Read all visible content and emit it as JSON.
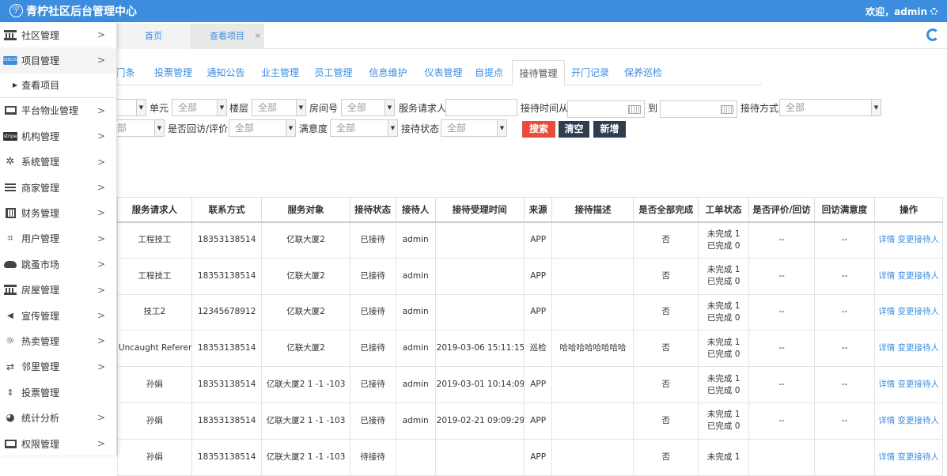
{
  "header": {
    "logo_char": "宁",
    "title": "青柠社区后台管理中心",
    "welcome": "欢迎，admin",
    "gear_icon": "gear-icon"
  },
  "sidebar": {
    "items": [
      {
        "label": "社区管理",
        "icon": "bank-icon",
        "has_arrow": true
      },
      {
        "label": "项目管理",
        "icon": "card-icon",
        "has_arrow": true,
        "open": true
      },
      {
        "label": "查看项目",
        "sub": true
      },
      {
        "label": "平台物业管理",
        "icon": "monitor-icon",
        "has_arrow": true
      },
      {
        "label": "机构管理",
        "icon": "stripe-icon",
        "has_arrow": true
      },
      {
        "label": "系统管理",
        "icon": "pinwheel-icon",
        "has_arrow": true
      },
      {
        "label": "商家管理",
        "icon": "menu-icon",
        "has_arrow": true
      },
      {
        "label": "财务管理",
        "icon": "calculator-icon",
        "has_arrow": true
      },
      {
        "label": "用户管理",
        "icon": "crop-icon",
        "has_arrow": true
      },
      {
        "label": "跳蚤市场",
        "icon": "cloud-icon",
        "has_arrow": true
      },
      {
        "label": "房屋管理",
        "icon": "bank-icon",
        "has_arrow": true
      },
      {
        "label": "宣传管理",
        "icon": "speaker-icon",
        "has_arrow": true
      },
      {
        "label": "热卖管理",
        "icon": "sun-icon",
        "has_arrow": true
      },
      {
        "label": "邻里管理",
        "icon": "retweet-icon",
        "has_arrow": true
      },
      {
        "label": "投票管理",
        "icon": "sort-icon",
        "has_arrow": false
      },
      {
        "label": "统计分析",
        "icon": "pie-icon",
        "has_arrow": true
      },
      {
        "label": "权限管理",
        "icon": "monitor-icon",
        "has_arrow": true
      }
    ]
  },
  "page_tabs": [
    {
      "label": "首页"
    },
    {
      "label": "查看项目",
      "closable": true,
      "close": "×"
    }
  ],
  "section_tabs": [
    "门条",
    "投票管理",
    "通知公告",
    "业主管理",
    "员工管理",
    "信息维护",
    "仪表管理",
    "自提点",
    "接待管理",
    "开门记录",
    "保养巡检"
  ],
  "active_section": "接待管理",
  "filters": {
    "unit_label": "单元",
    "floor_label": "楼层",
    "room_label": "房间号",
    "requester_label": "服务请求人",
    "time_from_label": "接待时间从",
    "time_to_label": "到",
    "method_label": "接待方式",
    "revisit_label": "是否回访/评价",
    "satisfaction_label": "满意度",
    "status_label": "接待状态",
    "all": "全部",
    "partial_all": "部"
  },
  "buttons": {
    "search": "搜索",
    "clear": "清空",
    "add": "新增"
  },
  "table": {
    "columns": [
      "服务请求人",
      "联系方式",
      "服务对象",
      "接待状态",
      "接待人",
      "接待受理时间",
      "来源",
      "接待描述",
      "是否全部完成",
      "工单状态",
      "是否评价/回访",
      "回访满意度",
      "操作"
    ],
    "rows": [
      [
        "工程技工",
        "18353138514",
        "亿联大厦2",
        "已接待",
        "admin",
        "",
        "APP",
        "",
        "否",
        "未完成 1\n已完成 0",
        "--",
        "--"
      ],
      [
        "工程技工",
        "18353138514",
        "亿联大厦2",
        "已接待",
        "admin",
        "",
        "APP",
        "",
        "否",
        "未完成 1\n已完成 0",
        "--",
        "--"
      ],
      [
        "技工2",
        "12345678912",
        "亿联大厦2",
        "已接待",
        "admin",
        "",
        "APP",
        "",
        "否",
        "未完成 1\n已完成 0",
        "--",
        "--"
      ],
      [
        "Uncaught ReferenceEr",
        "18353138514",
        "亿联大厦2",
        "已接待",
        "admin",
        "2019-03-06 15:11:15",
        "巡检",
        "哈哈哈哈哈哈哈哈",
        "否",
        "未完成 1\n已完成 0",
        "--",
        "--"
      ],
      [
        "孙娟",
        "18353138514",
        "亿联大厦2 1 -1 -103",
        "已接待",
        "admin",
        "2019-03-01 10:14:09",
        "APP",
        "",
        "否",
        "未完成 1\n已完成 0",
        "--",
        "--"
      ],
      [
        "孙娟",
        "18353138514",
        "亿联大厦2 1 -1 -103",
        "已接待",
        "admin",
        "2019-02-21 09:09:29",
        "APP",
        "",
        "否",
        "未完成 1\n已完成 0",
        "--",
        "--"
      ],
      [
        "孙娟",
        "18353138514",
        "亿联大厦2 1 -1 -103",
        "待接待",
        "",
        "",
        "APP",
        "",
        "否",
        "未完成 1",
        "",
        ""
      ]
    ],
    "actions": {
      "detail": "详情",
      "change": "变更接待人"
    }
  }
}
